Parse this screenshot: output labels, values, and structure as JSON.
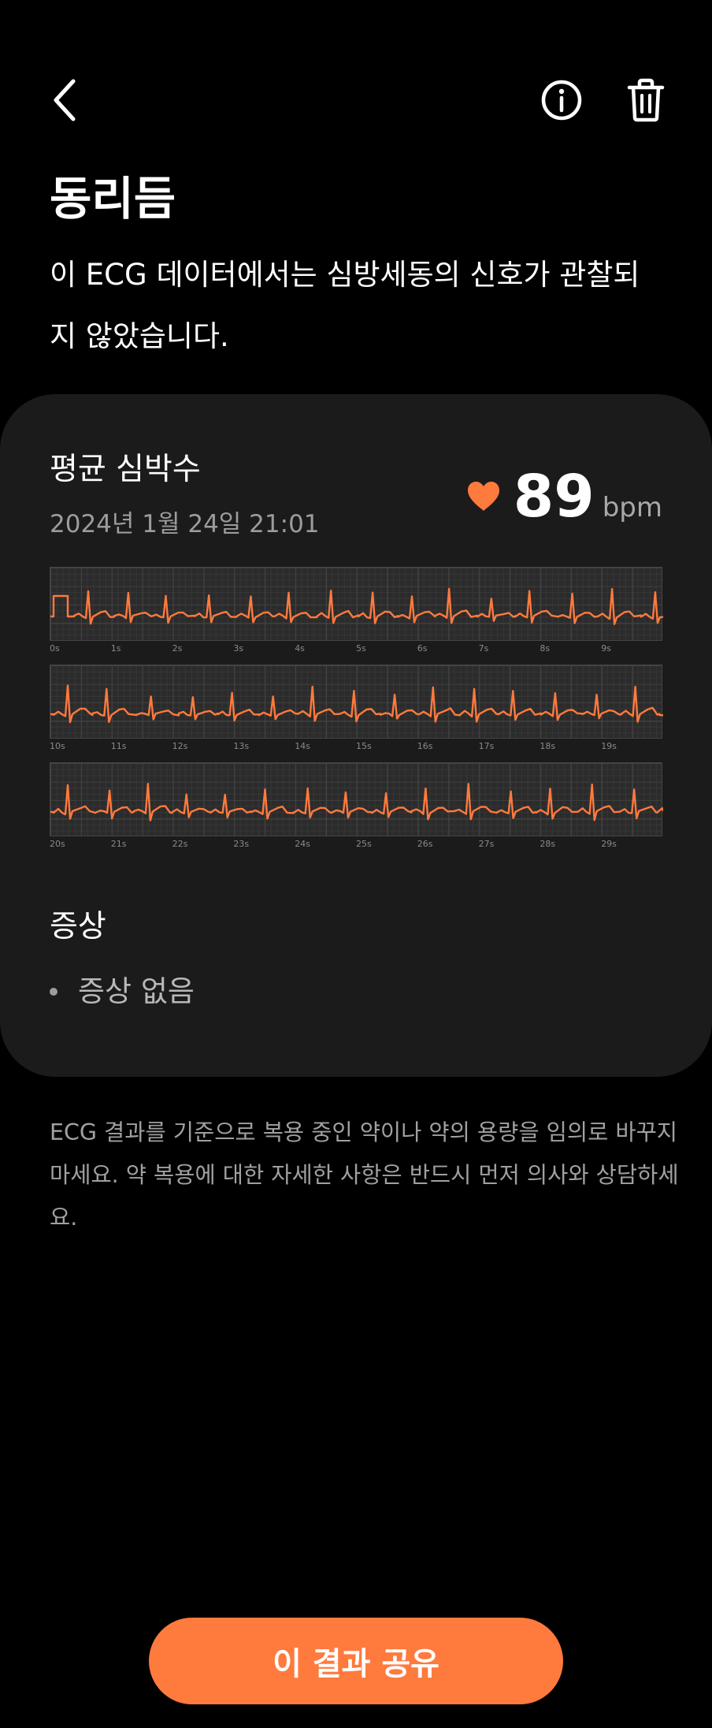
{
  "header": {
    "back_icon": "chevron-left-icon",
    "info_icon": "info-icon",
    "delete_icon": "trash-icon"
  },
  "result": {
    "title": "동리듬",
    "description": "이 ECG 데이터에서는 심방세동의 신호가 관찰되지 않았습니다."
  },
  "card": {
    "avg_label": "평균 심박수",
    "date": "2024년 1월 24일 21:01",
    "heart_rate": "89",
    "unit": "bpm",
    "heart_icon": "heart-icon",
    "symptoms_title": "증상",
    "symptoms": [
      "증상 없음"
    ]
  },
  "ecg": {
    "line_color": "#ff7a3d",
    "strips": [
      {
        "ticks": [
          "0s",
          "1s",
          "2s",
          "3s",
          "4s",
          "5s",
          "6s",
          "7s",
          "8s",
          "9s"
        ]
      },
      {
        "ticks": [
          "10s",
          "11s",
          "12s",
          "13s",
          "14s",
          "15s",
          "16s",
          "17s",
          "18s",
          "19s"
        ]
      },
      {
        "ticks": [
          "20s",
          "21s",
          "22s",
          "23s",
          "24s",
          "25s",
          "26s",
          "27s",
          "28s",
          "29s"
        ]
      }
    ]
  },
  "disclaimer": "ECG 결과를 기준으로 복용 중인 약이나 약의 용량을 임의로 바꾸지 마세요. 약 복용에 대한 자세한 사항은 반드시 먼저 의사와 상담하세요.",
  "footer": {
    "share_label": "이 결과 공유"
  },
  "colors": {
    "accent": "#ff7a3d",
    "card_bg": "#1b1b1b",
    "page_bg": "#000000"
  }
}
